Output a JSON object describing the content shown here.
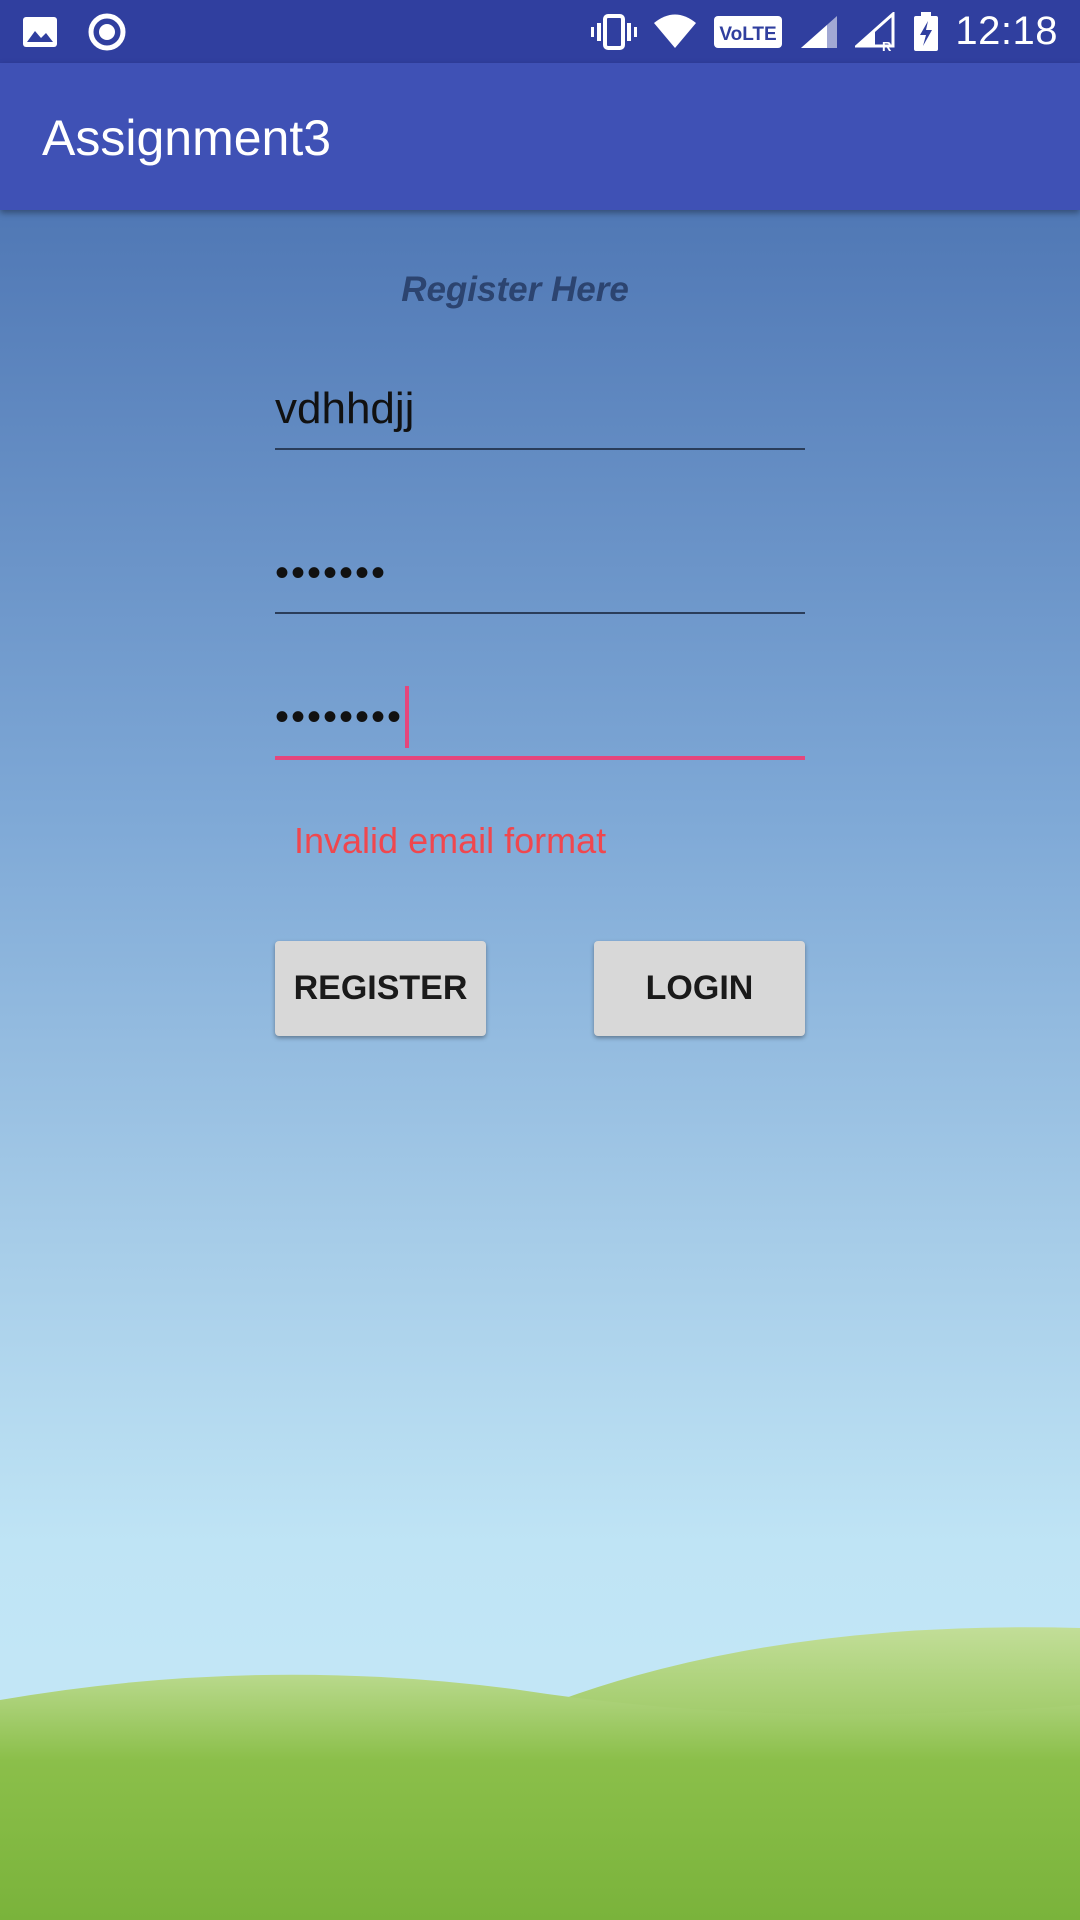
{
  "status_bar": {
    "time": "12:18",
    "volte_label": "VoLTE",
    "roaming_label": "R",
    "icons": [
      "image-icon",
      "record-icon",
      "vibrate-icon",
      "wifi-icon",
      "volte-icon",
      "signal-icon",
      "signal-roaming-icon",
      "battery-charging-icon"
    ]
  },
  "app_bar": {
    "title": "Assignment3"
  },
  "form": {
    "heading": "Register Here",
    "username_value": "vdhhdjj",
    "password_value": "•••••••",
    "email_value": "••••••••",
    "error_message": "Invalid email format"
  },
  "buttons": {
    "register_label": "REGISTER",
    "login_label": "LOGIN"
  },
  "colors": {
    "status_bar": "#303F9F",
    "app_bar": "#3F51B5",
    "accent": "#E5467C",
    "error": "#F0474E"
  }
}
